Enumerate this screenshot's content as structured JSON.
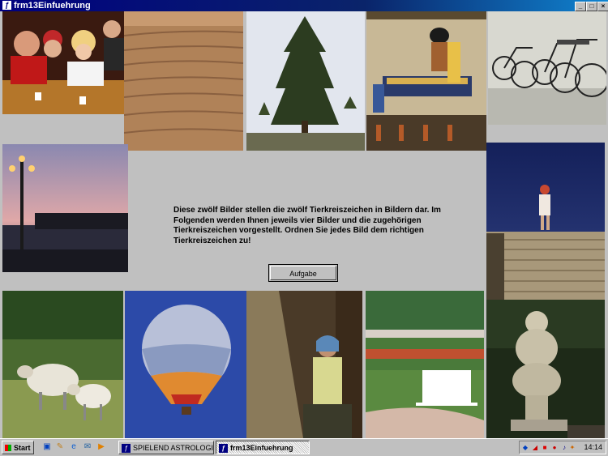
{
  "window": {
    "title": "frm13Einfuehrung",
    "icon": "app-icon"
  },
  "main": {
    "info_text": "Diese zwölf Bilder stellen die zwölf Tierkreiszeichen in Bildern dar. Im Folgenden werden Ihnen jeweils vier Bilder und die zugehörigen Tierkreiszeichen vorgestellt. Ordnen Sie jedes Bild dem richtigen Tierkreiszeichen zu!",
    "task_button_label": "Aufgabe",
    "photos": [
      "people-playing-cards",
      "raked-sand-field",
      "fir-tree",
      "egyptian-mural",
      "bicycles",
      "lantern-harbor",
      "woman-on-stairs",
      "sheep",
      "hot-air-balloon",
      "woman-at-mill",
      "garden-bench",
      "stone-venus-statue"
    ]
  },
  "taskbar": {
    "start_label": "Start",
    "tasks": [
      {
        "label": "SPIELEND ASTROLOGIE ...",
        "active": false
      },
      {
        "label": "frm13Einfuehrung",
        "active": true
      }
    ],
    "clock": "14:14"
  }
}
